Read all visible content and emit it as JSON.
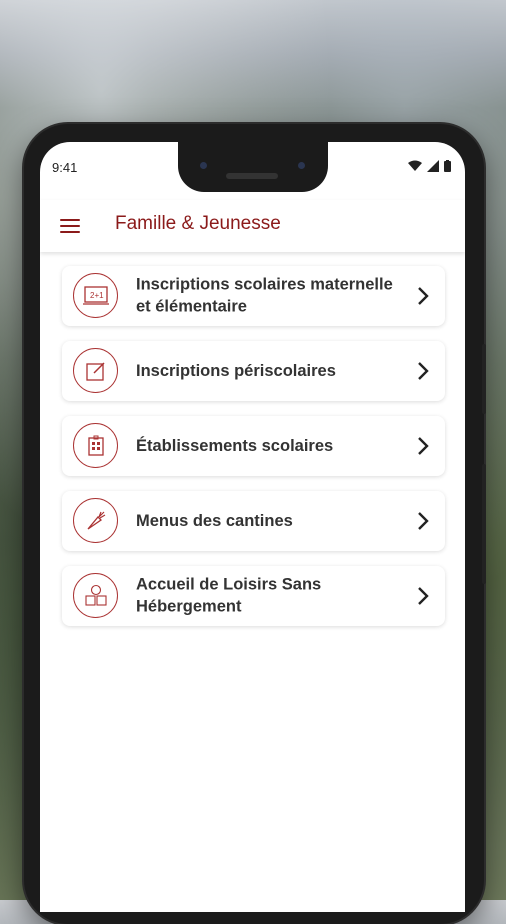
{
  "status_bar": {
    "time": "9:41"
  },
  "app_bar": {
    "title": "Famille & Jeunesse"
  },
  "menu": [
    {
      "label": "Inscriptions scolaires maternelle et élémentaire",
      "icon": "school-board-icon"
    },
    {
      "label": "Inscriptions périscolaires",
      "icon": "edit-note-icon"
    },
    {
      "label": "Établissements scolaires",
      "icon": "school-building-icon"
    },
    {
      "label": "Menus des cantines",
      "icon": "carrot-icon"
    },
    {
      "label": "Accueil de Loisirs Sans Hébergement",
      "icon": "abc-blocks-icon"
    }
  ],
  "colors": {
    "accent": "#8b1a1a",
    "icon_stroke": "#a33333"
  }
}
